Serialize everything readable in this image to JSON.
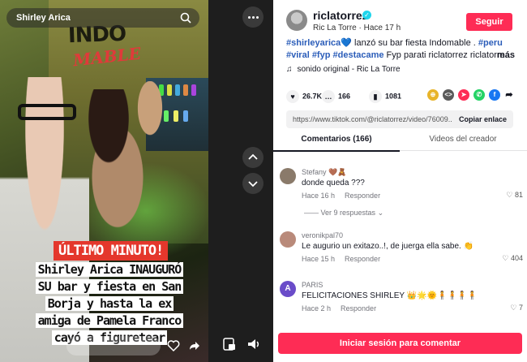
{
  "video": {
    "search_text": "Shirley Arica",
    "sign_line1": "INDO",
    "sign_line2": "MABLE",
    "banner": "ÚLTIMO MINUTO!",
    "caption": "Shirley Arica INAUGURÓ SU bar y fiesta en San Borja y hasta la ex amiga de Pamela Franco cayó a figuretear"
  },
  "author": {
    "username": "riclatorrez",
    "display_name": "Ric La Torre",
    "time_ago": "Hace 17 h",
    "follow_label": "Seguir"
  },
  "description": {
    "parts": [
      {
        "t": "#shirleyarica",
        "h": true
      },
      {
        "t": "💙 lanzó su bar fiesta Indomable . ",
        "h": false
      },
      {
        "t": "#peru",
        "h": true
      },
      {
        "t": " ",
        "h": false
      },
      {
        "t": "#viral",
        "h": true
      },
      {
        "t": " ",
        "h": false
      },
      {
        "t": "#fyp",
        "h": true
      },
      {
        "t": " ",
        "h": false
      },
      {
        "t": "#destacame",
        "h": true
      },
      {
        "t": " Fyp parati riclatorrez riclatorre...",
        "h": false
      }
    ],
    "more_label": "más"
  },
  "sound": {
    "icon": "music-note-icon",
    "label": "sonido original - Ric La Torre"
  },
  "stats": {
    "likes": "26.7K",
    "comments": "166",
    "saves": "1081"
  },
  "share_icons": [
    "embed-icon",
    "share-icon",
    "send-icon",
    "whatsapp-icon",
    "facebook-icon",
    "forward-icon"
  ],
  "link": {
    "url": "https://www.tiktok.com/@riclatorrez/video/76009...",
    "copy_label": "Copiar enlace"
  },
  "tabs": {
    "comments": "Comentarios (166)",
    "creator_videos": "Videos del creador"
  },
  "comments": [
    {
      "name": "Stefany 🤎🧸",
      "text": "donde queda ???",
      "time": "Hace 16 h",
      "reply": "Responder",
      "likes": "81",
      "avatar_color": "#8a7a6a"
    },
    {
      "name": "veronikpal70",
      "text": "Le augurio un exitazo..!, de juerga ella sabe. 👏",
      "time": "Hace 15 h",
      "reply": "Responder",
      "likes": "404",
      "avatar_color": "#b98a7a"
    },
    {
      "name": "PARIS",
      "text": "FELICITACIONES SHIRLEY 👑🌟🌞🧍🧍🧍🧍",
      "time": "Hace 2 h",
      "reply": "Responder",
      "likes": "7",
      "avatar_color": "#6a4cc9",
      "avatar_letter": "A"
    }
  ],
  "view_replies": "Ver 9 respuestas",
  "login_label": "Iniciar sesión para comentar",
  "colors": {
    "accent": "#fe2c55",
    "hashtag": "#2b5db9",
    "verified": "#20d5ec"
  }
}
